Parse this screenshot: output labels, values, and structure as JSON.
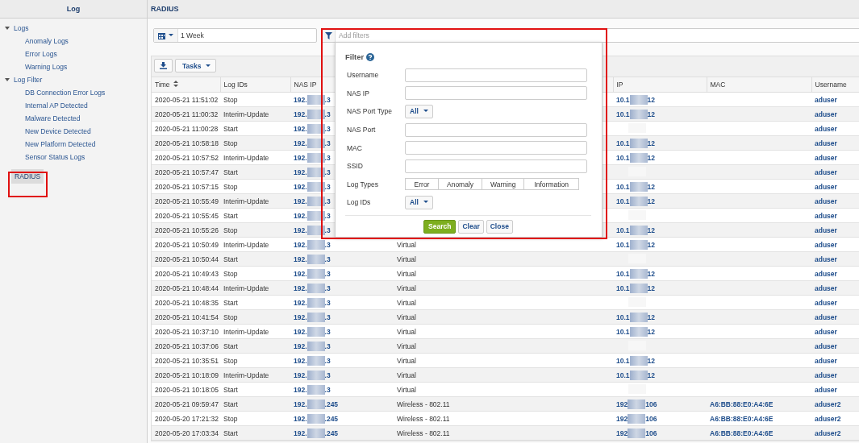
{
  "sidebar": {
    "title": "Log",
    "tree": [
      {
        "label": "Logs",
        "expanded": true,
        "selected": false,
        "children": [
          {
            "label": "Anomaly Logs",
            "selected": false
          },
          {
            "label": "Error Logs",
            "selected": false
          },
          {
            "label": "Warning Logs",
            "selected": false
          }
        ]
      },
      {
        "label": "Log Filter",
        "expanded": true,
        "selected": false,
        "children": [
          {
            "label": "DB Connection Error Logs",
            "selected": false
          },
          {
            "label": "Internal AP Detected",
            "selected": false
          },
          {
            "label": "Malware Detected",
            "selected": false
          },
          {
            "label": "New Device Detected",
            "selected": false
          },
          {
            "label": "New Platform Detected",
            "selected": false
          },
          {
            "label": "Sensor Status Logs",
            "selected": false
          }
        ]
      },
      {
        "label": "RADIUS",
        "selected": true
      }
    ]
  },
  "main": {
    "title": "RADIUS",
    "date_range": {
      "value": "1 Week"
    },
    "filter_field": {
      "placeholder": "Add filters"
    },
    "toolbar": {
      "tasks_label": "Tasks"
    },
    "filter_popup": {
      "title": "Filter",
      "fields": [
        {
          "kind": "text",
          "label": "Username"
        },
        {
          "kind": "text",
          "label": "NAS IP"
        },
        {
          "kind": "select",
          "label": "NAS Port Type",
          "value": "All"
        },
        {
          "kind": "text",
          "label": "NAS Port"
        },
        {
          "kind": "text",
          "label": "MAC"
        },
        {
          "kind": "text",
          "label": "SSID"
        },
        {
          "kind": "segments",
          "label": "Log Types",
          "options": [
            "Error",
            "Anomaly",
            "Warning",
            "Information"
          ]
        },
        {
          "kind": "select",
          "label": "Log IDs",
          "value": "All"
        }
      ],
      "buttons": [
        {
          "label": "Search",
          "kind": "primary"
        },
        {
          "label": "Clear",
          "kind": "default"
        },
        {
          "label": "Close",
          "kind": "default"
        }
      ]
    },
    "table": {
      "columns": [
        "Time",
        "Log IDs",
        "NAS IP",
        "",
        "IP",
        "MAC",
        "Username"
      ],
      "rows": [
        {
          "time": "2020-05-21 11:51:02",
          "log_id": "Stop",
          "nas_ip": [
            "192.",
            ".3"
          ],
          "ip": [
            "10.1",
            "12"
          ],
          "mac": "",
          "username": "aduser"
        },
        {
          "time": "2020-05-21 11:00:32",
          "log_id": "Interim-Update",
          "nas_ip": [
            "192.",
            ".3"
          ],
          "ip": [
            "10.1",
            "12"
          ],
          "mac": "",
          "username": "aduser"
        },
        {
          "time": "2020-05-21 11:00:28",
          "log_id": "Start",
          "nas_ip": [
            "192.",
            ".3"
          ],
          "ip": null,
          "mac": "",
          "username": "aduser"
        },
        {
          "time": "2020-05-21 10:58:18",
          "log_id": "Stop",
          "nas_ip": [
            "192.",
            ".3"
          ],
          "ip": [
            "10.1",
            "12"
          ],
          "mac": "",
          "username": "aduser"
        },
        {
          "time": "2020-05-21 10:57:52",
          "log_id": "Interim-Update",
          "nas_ip": [
            "192.",
            ".3"
          ],
          "ip": [
            "10.1",
            "12"
          ],
          "mac": "",
          "username": "aduser"
        },
        {
          "time": "2020-05-21 10:57:47",
          "log_id": "Start",
          "nas_ip": [
            "192.",
            ".3"
          ],
          "ip": null,
          "mac": "",
          "username": "aduser"
        },
        {
          "time": "2020-05-21 10:57:15",
          "log_id": "Stop",
          "nas_ip": [
            "192.",
            ".3"
          ],
          "ip": [
            "10.1",
            "12"
          ],
          "mac": "",
          "username": "aduser"
        },
        {
          "time": "2020-05-21 10:55:49",
          "log_id": "Interim-Update",
          "nas_ip": [
            "192.",
            ".3"
          ],
          "ip": [
            "10.1",
            "12"
          ],
          "mac": "",
          "username": "aduser"
        },
        {
          "time": "2020-05-21 10:55:45",
          "log_id": "Start",
          "nas_ip": [
            "192.",
            ".3"
          ],
          "ip": null,
          "mac": "",
          "username": "aduser"
        },
        {
          "time": "2020-05-21 10:55:26",
          "log_id": "Stop",
          "nas_ip": [
            "192.",
            ".3"
          ],
          "ip": [
            "10.1",
            "12"
          ],
          "mac": "",
          "username": "aduser"
        },
        {
          "time": "2020-05-21 10:50:49",
          "log_id": "Interim-Update",
          "nas_ip": [
            "192.",
            ".3"
          ],
          "port_type": "Virtual",
          "ip": [
            "10.1",
            "12"
          ],
          "mac": "",
          "username": "aduser"
        },
        {
          "time": "2020-05-21 10:50:44",
          "log_id": "Start",
          "nas_ip": [
            "192.",
            ".3"
          ],
          "port_type": "Virtual",
          "ip": null,
          "mac": "",
          "username": "aduser"
        },
        {
          "time": "2020-05-21 10:49:43",
          "log_id": "Stop",
          "nas_ip": [
            "192.",
            ".3"
          ],
          "port_type": "Virtual",
          "ip": [
            "10.1",
            "12"
          ],
          "mac": "",
          "username": "aduser"
        },
        {
          "time": "2020-05-21 10:48:44",
          "log_id": "Interim-Update",
          "nas_ip": [
            "192.",
            ".3"
          ],
          "port_type": "Virtual",
          "ip": [
            "10.1",
            "12"
          ],
          "mac": "",
          "username": "aduser"
        },
        {
          "time": "2020-05-21 10:48:35",
          "log_id": "Start",
          "nas_ip": [
            "192.",
            ".3"
          ],
          "port_type": "Virtual",
          "ip": null,
          "mac": "",
          "username": "aduser"
        },
        {
          "time": "2020-05-21 10:41:54",
          "log_id": "Stop",
          "nas_ip": [
            "192.",
            ".3"
          ],
          "port_type": "Virtual",
          "ip": [
            "10.1",
            "12"
          ],
          "mac": "",
          "username": "aduser"
        },
        {
          "time": "2020-05-21 10:37:10",
          "log_id": "Interim-Update",
          "nas_ip": [
            "192.",
            ".3"
          ],
          "port_type": "Virtual",
          "ip": [
            "10.1",
            "12"
          ],
          "mac": "",
          "username": "aduser"
        },
        {
          "time": "2020-05-21 10:37:06",
          "log_id": "Start",
          "nas_ip": [
            "192.",
            ".3"
          ],
          "port_type": "Virtual",
          "ip": null,
          "mac": "",
          "username": "aduser"
        },
        {
          "time": "2020-05-21 10:35:51",
          "log_id": "Stop",
          "nas_ip": [
            "192.",
            ".3"
          ],
          "port_type": "Virtual",
          "ip": [
            "10.1",
            "12"
          ],
          "mac": "",
          "username": "aduser"
        },
        {
          "time": "2020-05-21 10:18:09",
          "log_id": "Interim-Update",
          "nas_ip": [
            "192.",
            ".3"
          ],
          "port_type": "Virtual",
          "ip": [
            "10.1",
            "12"
          ],
          "mac": "",
          "username": "aduser"
        },
        {
          "time": "2020-05-21 10:18:05",
          "log_id": "Start",
          "nas_ip": [
            "192.",
            ".3"
          ],
          "port_type": "Virtual",
          "ip": null,
          "mac": "",
          "username": "aduser"
        },
        {
          "time": "2020-05-21 09:59:47",
          "log_id": "Start",
          "nas_ip": [
            "192.",
            ".245"
          ],
          "port_type": "Wireless - 802.11",
          "ip": [
            "192",
            "106"
          ],
          "mac": "A6:BB:88:E0:A4:6E",
          "username": "aduser2"
        },
        {
          "time": "2020-05-20 17:21:32",
          "log_id": "Stop",
          "nas_ip": [
            "192.",
            ".245"
          ],
          "port_type": "Wireless - 802.11",
          "ip": [
            "192",
            "106"
          ],
          "mac": "A6:BB:88:E0:A4:6E",
          "username": "aduser2"
        },
        {
          "time": "2020-05-20 17:03:34",
          "log_id": "Start",
          "nas_ip": [
            "192.",
            ".245"
          ],
          "port_type": "Wireless - 802.11",
          "ip": [
            "192",
            "106"
          ],
          "mac": "A6:BB:88:E0:A4:6E",
          "username": "aduser2"
        }
      ]
    }
  }
}
